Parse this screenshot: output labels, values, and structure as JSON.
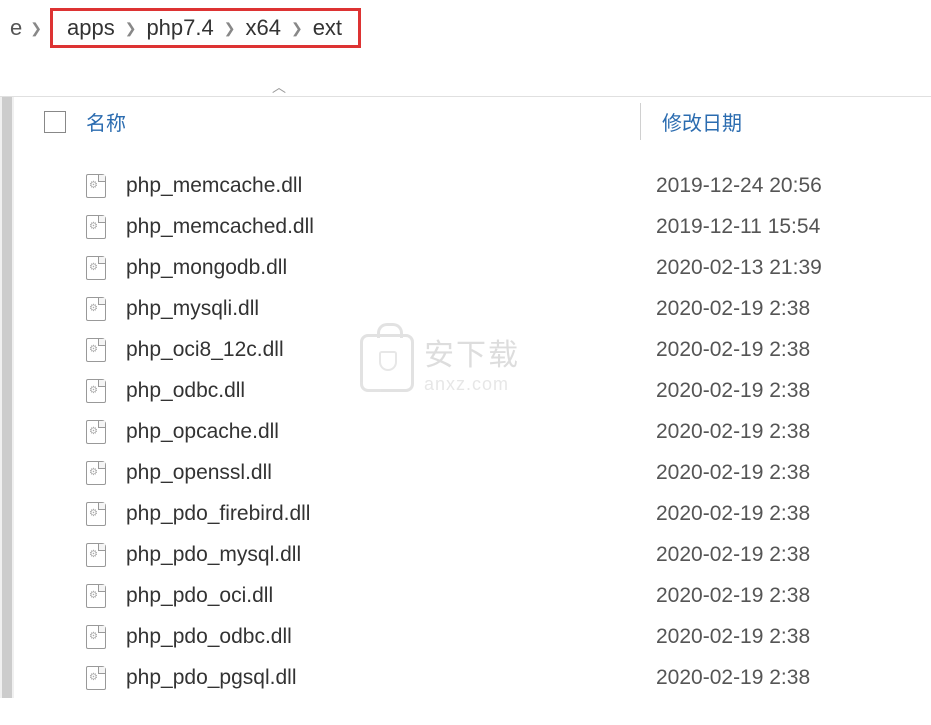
{
  "breadcrumb": {
    "prefix_fragment": "e",
    "items": [
      "apps",
      "php7.4",
      "x64",
      "ext"
    ]
  },
  "columns": {
    "name": "名称",
    "date": "修改日期"
  },
  "files": [
    {
      "name": "php_memcache.dll",
      "date": "2019-12-24 20:56"
    },
    {
      "name": "php_memcached.dll",
      "date": "2019-12-11 15:54"
    },
    {
      "name": "php_mongodb.dll",
      "date": "2020-02-13 21:39"
    },
    {
      "name": "php_mysqli.dll",
      "date": "2020-02-19 2:38"
    },
    {
      "name": "php_oci8_12c.dll",
      "date": "2020-02-19 2:38"
    },
    {
      "name": "php_odbc.dll",
      "date": "2020-02-19 2:38"
    },
    {
      "name": "php_opcache.dll",
      "date": "2020-02-19 2:38"
    },
    {
      "name": "php_openssl.dll",
      "date": "2020-02-19 2:38"
    },
    {
      "name": "php_pdo_firebird.dll",
      "date": "2020-02-19 2:38"
    },
    {
      "name": "php_pdo_mysql.dll",
      "date": "2020-02-19 2:38"
    },
    {
      "name": "php_pdo_oci.dll",
      "date": "2020-02-19 2:38"
    },
    {
      "name": "php_pdo_odbc.dll",
      "date": "2020-02-19 2:38"
    },
    {
      "name": "php_pdo_pgsql.dll",
      "date": "2020-02-19 2:38"
    }
  ],
  "watermark": {
    "cn": "安下载",
    "en": "anxz.com"
  }
}
